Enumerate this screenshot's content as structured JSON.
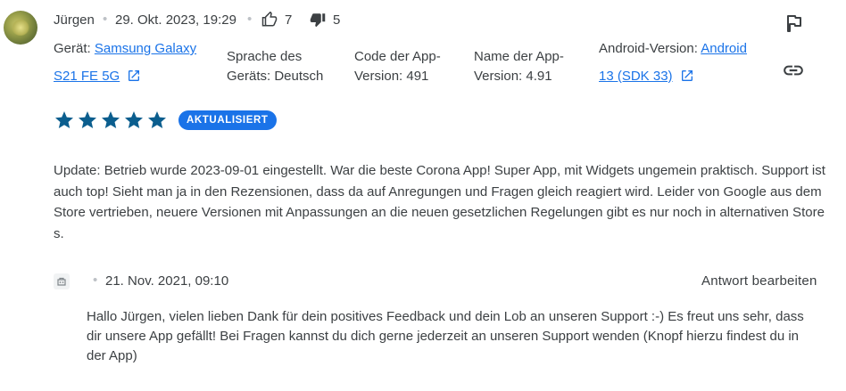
{
  "review": {
    "author": "Jürgen",
    "date": "29. Okt. 2023, 19:29",
    "thumbs_up_count": "7",
    "thumbs_down_count": "5",
    "rating": 5,
    "badge": "AKTUALISIERT",
    "text": "Update: Betrieb wurde 2023-09-01 eingestellt. War die beste Corona App! Super App, mit Widgets ungemein praktisch. Support ist auch top! Sieht man ja in den Rezensionen, dass da auf Anregungen und Fragen gleich reagiert wird. Leider von Google aus dem Store vertrieben, neuere Versionen mit Anpassungen an die neuen gesetzlichen Regelungen gibt es nur noch in alternativen Stores."
  },
  "device_info": {
    "device_label": "Gerät:",
    "device_line1": "Samsung Galaxy",
    "device_line2": "S21 FE 5G",
    "language_line1": "Sprache des",
    "language_line2": "Geräts: Deutsch",
    "code_line1": "Code der App-",
    "code_line2": "Version: 491",
    "name_line1": "Name der App-",
    "name_line2": "Version: 4.91",
    "android_label": "Android-Version:",
    "android_line1": "Android",
    "android_line2": "13 (SDK 33)"
  },
  "reply": {
    "date": "21. Nov. 2021, 09:10",
    "edit_label": "Antwort bearbeiten",
    "text": "Hallo Jürgen, vielen lieben Dank für dein positives Feedback und dein Lob an unseren Support :-) Es freut uns sehr, dass dir unsere App gefällt! Bei Fragen kannst du dich gerne jederzeit an unseren Support wenden (Knopf hierzu findest du in der App)"
  },
  "icons": {
    "flag": "flag-icon",
    "link": "link-icon",
    "thumb_up": "thumb-up-icon",
    "thumb_down": "thumb-down-icon",
    "external": "open-in-new-icon",
    "developer": "developer-icon",
    "star": "star-icon"
  },
  "colors": {
    "star": "#0b5e8e",
    "badge": "#1a73e8",
    "link": "#1a73e8",
    "text": "#3c4043"
  }
}
